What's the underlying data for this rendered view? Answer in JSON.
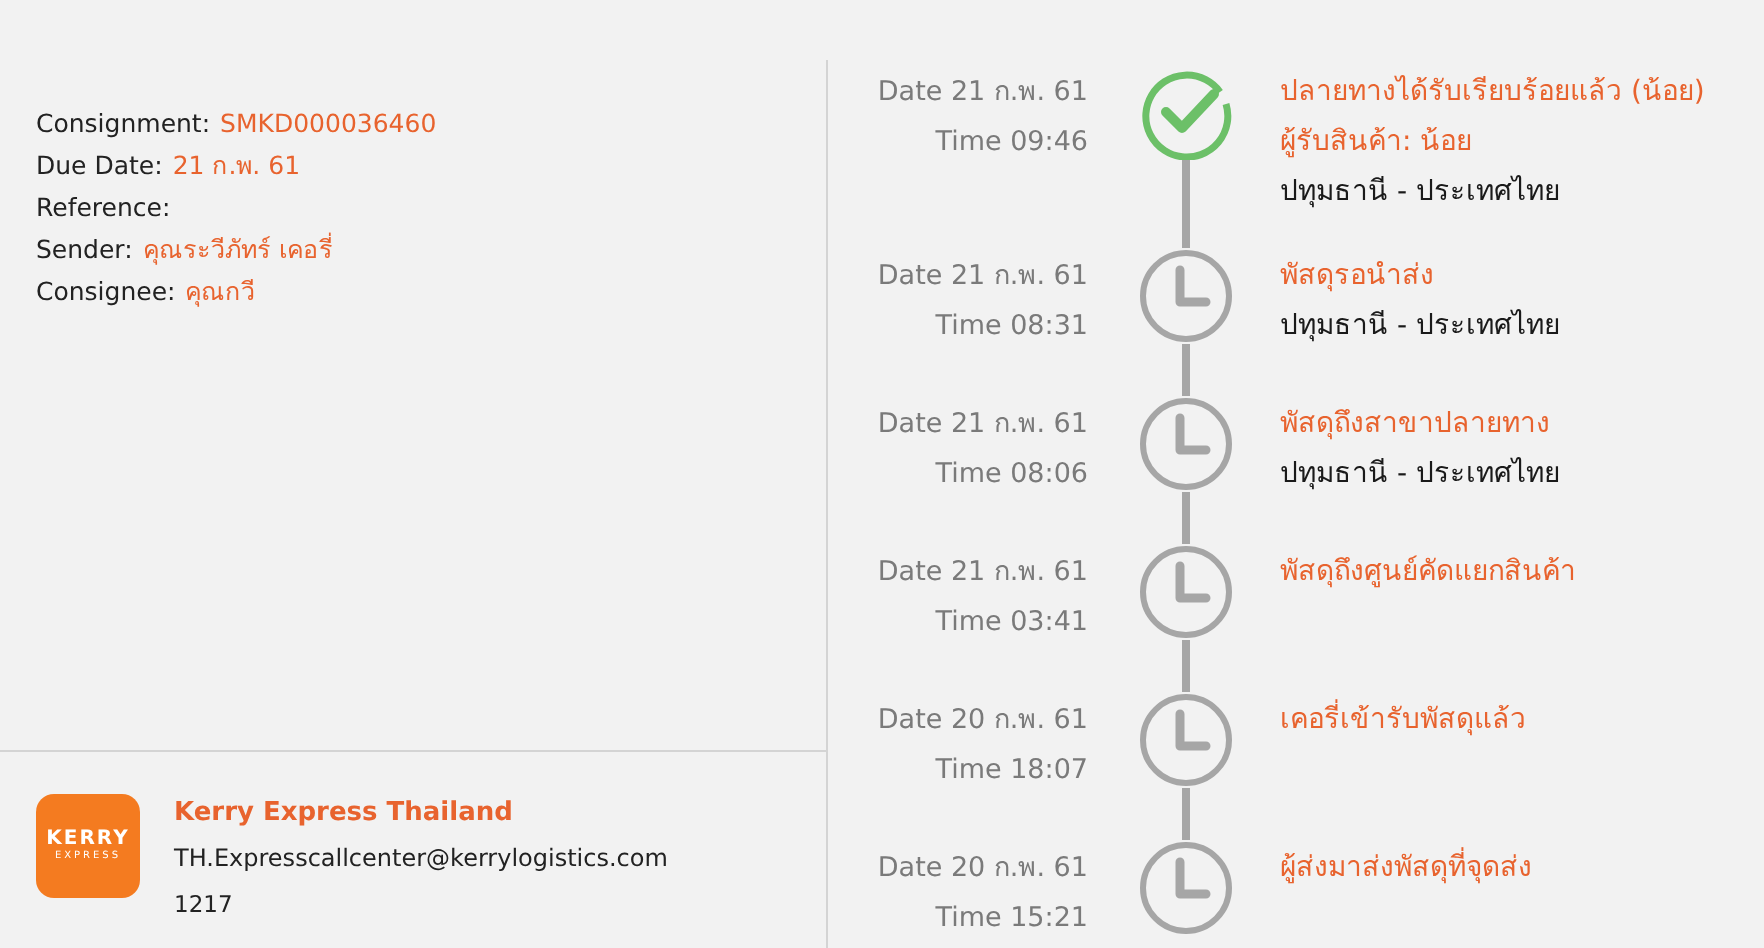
{
  "details": [
    {
      "label": "Consignment:",
      "value": "SMKD000036460"
    },
    {
      "label": "Due Date:",
      "value": "21 ก.พ. 61"
    },
    {
      "label": "Reference:"
    },
    {
      "label": "Sender:",
      "value": "คุณระวีภัทร์ เคอรี่"
    },
    {
      "label": "Consignee:",
      "value": "คุณกวี"
    }
  ],
  "company": {
    "logo_top": "KERRY",
    "logo_bottom": "EXPRESS",
    "name": "Kerry Express Thailand",
    "email": "TH.Expresscallcenter@kerrylogistics.com",
    "phone": "1217"
  },
  "events": [
    {
      "kind": "done",
      "date": "Date 21 ก.พ. 61",
      "time": "Time 09:46",
      "lines": [
        {
          "kind": "status",
          "text": "ปลายทางได้รับเรียบร้อยแล้ว (น้อย)"
        },
        {
          "kind": "status",
          "text": "ผู้รับสินค้า: น้อย"
        },
        {
          "kind": "location",
          "text": "ปทุมธานี - ประเทศไทย"
        }
      ]
    },
    {
      "kind": "pending",
      "date": "Date 21 ก.พ. 61",
      "time": "Time 08:31",
      "lines": [
        {
          "kind": "status",
          "text": "พัสดุรอนำส่ง"
        },
        {
          "kind": "location",
          "text": "ปทุมธานี - ประเทศไทย"
        }
      ]
    },
    {
      "kind": "pending",
      "date": "Date 21 ก.พ. 61",
      "time": "Time 08:06",
      "lines": [
        {
          "kind": "status",
          "text": "พัสดุถึงสาขาปลายทาง"
        },
        {
          "kind": "location",
          "text": "ปทุมธานี - ประเทศไทย"
        }
      ]
    },
    {
      "kind": "pending",
      "date": "Date 21 ก.พ. 61",
      "time": "Time 03:41",
      "lines": [
        {
          "kind": "status",
          "text": "พัสดุถึงศูนย์คัดแยกสินค้า"
        }
      ]
    },
    {
      "kind": "pending",
      "date": "Date 20 ก.พ. 61",
      "time": "Time 18:07",
      "lines": [
        {
          "kind": "status",
          "text": "เคอรี่เข้ารับพัสดุแล้ว"
        }
      ]
    },
    {
      "kind": "pending",
      "date": "Date 20 ก.พ. 61",
      "time": "Time 15:21",
      "lines": [
        {
          "kind": "status",
          "text": "ผู้ส่งมาส่งพัสดุที่จุดส่ง"
        }
      ]
    }
  ]
}
